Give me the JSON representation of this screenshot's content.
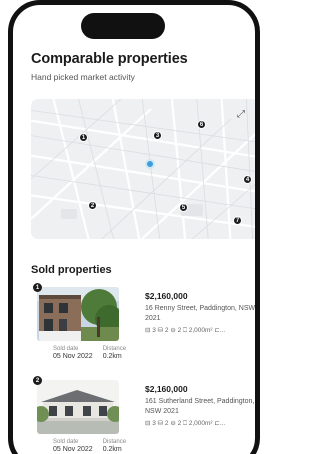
{
  "header": {
    "title": "Comparable properties",
    "subtitle": "Hand picked market activity"
  },
  "map": {
    "expand_icon": "expand-icon",
    "pins": [
      "1",
      "2",
      "3",
      "4",
      "5",
      "6",
      "7"
    ]
  },
  "sold": {
    "title": "Sold properties",
    "items": [
      {
        "badge": "1",
        "price": "$2,160,000",
        "address": "16 Renny Street, Paddington, NSW 2021",
        "features": "⊟ 3  ⛁ 2  ⊖ 2  ⎕ 2,000m²  ⊏...",
        "sold_label": "Sold date",
        "sold_date": "05 Nov 2022",
        "distance_label": "Distance",
        "distance": "0.2km"
      },
      {
        "badge": "2",
        "price": "$2,160,000",
        "address": "161 Sutherland Street, Paddington, NSW 2021",
        "features": "⊟ 3  ⛁ 2  ⊖ 2  ⎕ 2,000m²  ⊏...",
        "sold_label": "Sold date",
        "sold_date": "05 Nov 2022",
        "distance_label": "Distance",
        "distance": "0.2km"
      }
    ]
  },
  "colors": {
    "home_pin": "#3a9fdc",
    "pin": "#1d1d1d",
    "map_bg": "#eef0f2"
  }
}
